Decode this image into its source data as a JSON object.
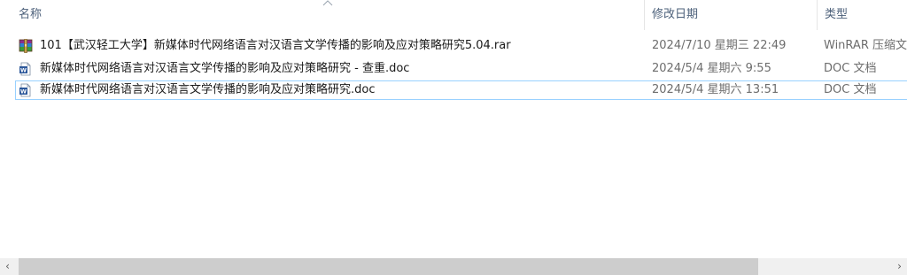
{
  "columns": {
    "name": "名称",
    "date_modified": "修改日期",
    "type": "类型"
  },
  "files": [
    {
      "icon": "winrar-archive-icon",
      "name": "101【武汉轻工大学】新媒体时代网络语言对汉语言文学传播的影响及应对策略研究5.04.rar",
      "date": "2024/7/10 星期三 22:49",
      "type": "WinRAR 压缩文"
    },
    {
      "icon": "word-doc-icon",
      "name": "新媒体时代网络语言对汉语言文学传播的影响及应对策略研究 - 查重.doc",
      "date": "2024/5/4 星期六 9:55",
      "type": "DOC 文档"
    },
    {
      "icon": "word-doc-icon",
      "name": "新媒体时代网络语言对汉语言文学传播的影响及应对策略研究.doc",
      "date": "2024/5/4 星期六 13:51",
      "type": "DOC 文档",
      "selected": true
    }
  ],
  "scrollbar": {
    "left_arrow": "‹",
    "right_arrow": "›"
  },
  "colors": {
    "header_text": "#4c607a",
    "selection_border": "#99d1ff",
    "word_blue": "#2b579a"
  }
}
